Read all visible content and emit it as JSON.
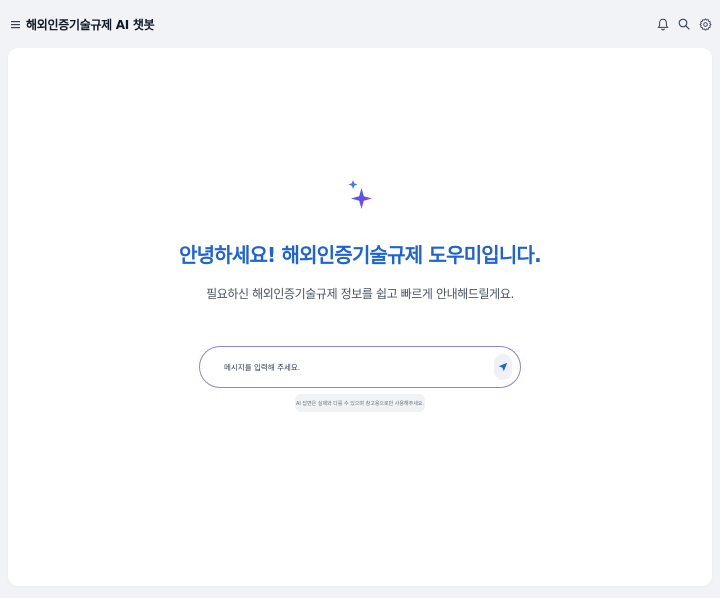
{
  "header": {
    "menu_icon": "hamburger-menu-icon",
    "title": "해외인증기술규제 AI 챗봇",
    "icons": [
      "bell-icon",
      "search-icon",
      "gear-icon"
    ]
  },
  "main": {
    "sparkle_icon": "sparkle-icon",
    "headline": "안녕하세요! 해외인증기술규제 도우미입니다.",
    "subline": "필요하신 해외인증기술규제 정보를 쉽고 빠르게 안내해드릴게요.",
    "input": {
      "placeholder": "메시지를 입력해 주세요.",
      "value": ""
    },
    "send_icon": "send-icon",
    "disclaimer": "AI 답변은 실제와 다를 수 있으며 참고용으로만 사용해주세요."
  },
  "colors": {
    "accent": "#1e63d6",
    "input_border": "#8b85e0",
    "background": "#f1f3f6",
    "card": "#ffffff"
  }
}
